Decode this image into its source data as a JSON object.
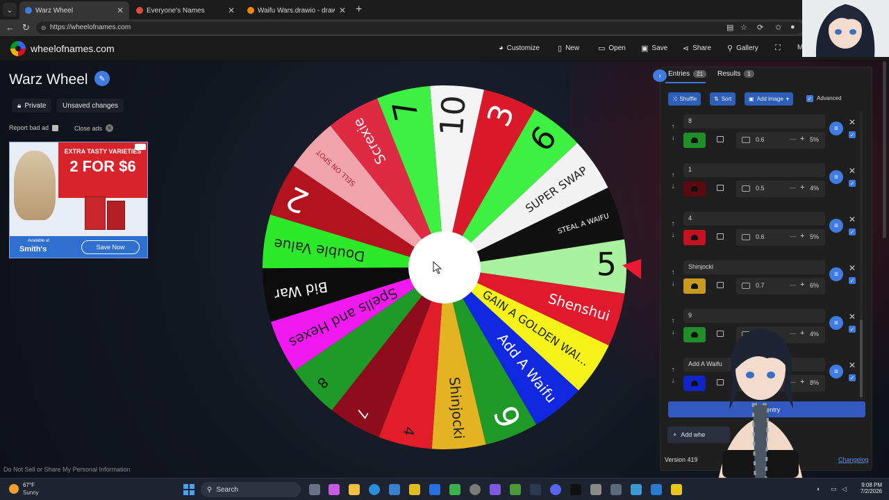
{
  "browser": {
    "tabs": [
      {
        "label": "Warz Wheel",
        "active": true,
        "favicon_color": "#3f7be0"
      },
      {
        "label": "Everyone's Names",
        "active": false,
        "favicon_color": "#e04a3f"
      },
      {
        "label": "Waifu Wars.drawio - draw.io",
        "active": false,
        "favicon_color": "#f08705"
      }
    ],
    "url": "https://wheelofnames.com"
  },
  "site": {
    "name": "wheelofnames.com",
    "menu": {
      "customize": "Customize",
      "new": "New",
      "open": "Open",
      "save": "Save",
      "share": "Share",
      "gallery": "Gallery",
      "more": "M"
    }
  },
  "left": {
    "title": "Warz Wheel",
    "private_label": "Private",
    "unsaved_label": "Unsaved changes",
    "report_ad": "Report bad ad",
    "close_ads": "Close ads",
    "privacy": "Do Not Sell or Share My Personal Information"
  },
  "ad": {
    "headline": "EXTRA TASTY VARIETIES",
    "offer": "2 FOR $6",
    "available": "Available at",
    "brand": "Smith's",
    "button": "Save Now"
  },
  "wheel": {
    "segments": [
      {
        "label": "10",
        "color": "#f4f4f4",
        "text_color": "#222222",
        "size": "big"
      },
      {
        "label": "3",
        "color": "#d91a2a",
        "text_color": "#ffffff",
        "size": "big"
      },
      {
        "label": "6",
        "color": "#3ef041",
        "text_color": "#111111",
        "size": "big"
      },
      {
        "label": "SUPER SWAP",
        "color": "#f2f2f2",
        "text_color": "#222222",
        "size": "small"
      },
      {
        "label": "STEAL A WAIFU",
        "color": "#111111",
        "text_color": "#ffffff",
        "size": "tiny"
      },
      {
        "label": "5",
        "color": "#a8f2a0",
        "text_color": "#111111",
        "size": "big"
      },
      {
        "label": "Shenshui",
        "color": "#e0192c",
        "text_color": "#ffffff",
        "size": "medium"
      },
      {
        "label": "GAIN A GOLDEN WAI...",
        "color": "#f5f21a",
        "text_color": "#222222",
        "size": "small"
      },
      {
        "label": "Add A Waifu",
        "color": "#1029e0",
        "text_color": "#ffffff",
        "size": "medium"
      },
      {
        "label": "9",
        "color": "#1f9a28",
        "text_color": "#ffffff",
        "size": "big"
      },
      {
        "label": "Shinjocki",
        "color": "#e3b324",
        "text_color": "#222222",
        "size": "medium"
      },
      {
        "label": "4",
        "color": "#e11d2a",
        "text_color": "#222222",
        "size": "medium"
      },
      {
        "label": "7",
        "color": "#8e0d1c",
        "text_color": "#ffffff",
        "size": "medium"
      },
      {
        "label": "8",
        "color": "#1f9a28",
        "text_color": "#111111",
        "size": "medium"
      },
      {
        "label": "Spells and Hexes",
        "color": "#f01af0",
        "text_color": "#222222",
        "size": "medium"
      },
      {
        "label": "Bid War",
        "color": "#0c0c0c",
        "text_color": "#ffffff",
        "size": "medium"
      },
      {
        "label": "Double Value",
        "color": "#2ee82a",
        "text_color": "#222222",
        "size": "medium"
      },
      {
        "label": "2",
        "color": "#b3121f",
        "text_color": "#ffffff",
        "size": "big"
      },
      {
        "label": "SELL ON SPOT",
        "color": "#f0a4aa",
        "text_color": "#b02030",
        "size": "tiny"
      },
      {
        "label": "Screxie",
        "color": "#df2a44",
        "text_color": "#f0f0f0",
        "size": "medium"
      },
      {
        "label": "7",
        "color": "#3ef041",
        "text_color": "#111111",
        "size": "big"
      }
    ]
  },
  "panel": {
    "entries_tab": "Entries",
    "entries_count": "21",
    "results_tab": "Results",
    "results_count": "1",
    "toolbar": {
      "shuffle": "Shuffle",
      "sort": "Sort",
      "add_image": "Add image",
      "advanced": "Advanced"
    },
    "entries": [
      {
        "name": "8",
        "color": "#1f8f2a",
        "weight": "0.6",
        "percent": "5%"
      },
      {
        "name": "1",
        "color": "#5a0a10",
        "weight": "0.5",
        "percent": "4%"
      },
      {
        "name": "4",
        "color": "#c41220",
        "weight": "0.6",
        "percent": "5%"
      },
      {
        "name": "Shinjocki",
        "color": "#c79a20",
        "weight": "0.7",
        "percent": "6%"
      },
      {
        "name": "9",
        "color": "#1f8f2a",
        "weight": "0.5",
        "percent": "4%"
      },
      {
        "name": "Add A Waifu",
        "color": "#1024c8",
        "weight": "",
        "percent": "8%"
      }
    ],
    "add_entry": "Add entry",
    "add_wheel": "Add whe",
    "version": "Version 419",
    "changelog": "Changelog"
  },
  "taskbar": {
    "temp": "67°F",
    "condition": "Sunny",
    "search": "Search",
    "time": "9:08 PM",
    "date": "7/2/2026"
  }
}
